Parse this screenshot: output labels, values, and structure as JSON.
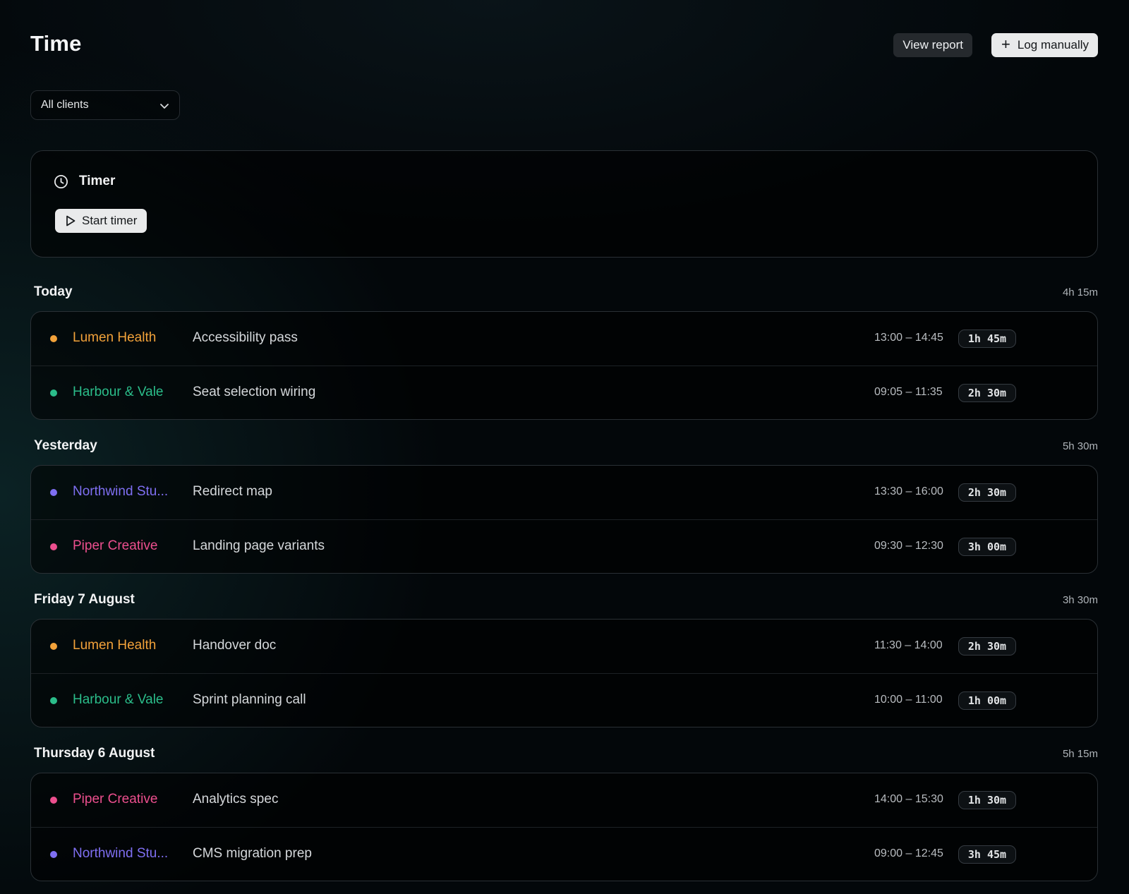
{
  "header": {
    "title": "Time",
    "view_report": "View report",
    "log_manually": "Log manually"
  },
  "filter": {
    "value": "All clients"
  },
  "timer": {
    "label": "Timer",
    "start": "Start timer"
  },
  "colors": {
    "lumen": "#f2a23a",
    "harbour": "#2bbd8a",
    "northwind": "#7f6ff2",
    "piper": "#ec4f8e"
  },
  "days": [
    {
      "label": "Today",
      "total": "4h 15m",
      "entries": [
        {
          "client": "Lumen Health",
          "color": "lumen",
          "task": "Accessibility pass",
          "range": "13:00 – 14:45",
          "duration": "1h 45m"
        },
        {
          "client": "Harbour & Vale",
          "color": "harbour",
          "task": "Seat selection wiring",
          "range": "09:05 – 11:35",
          "duration": "2h 30m"
        }
      ]
    },
    {
      "label": "Yesterday",
      "total": "5h 30m",
      "entries": [
        {
          "client": "Northwind Stu...",
          "color": "northwind",
          "task": "Redirect map",
          "range": "13:30 – 16:00",
          "duration": "2h 30m"
        },
        {
          "client": "Piper Creative",
          "color": "piper",
          "task": "Landing page variants",
          "range": "09:30 – 12:30",
          "duration": "3h 00m"
        }
      ]
    },
    {
      "label": "Friday 7 August",
      "total": "3h 30m",
      "entries": [
        {
          "client": "Lumen Health",
          "color": "lumen",
          "task": "Handover doc",
          "range": "11:30 – 14:00",
          "duration": "2h 30m"
        },
        {
          "client": "Harbour & Vale",
          "color": "harbour",
          "task": "Sprint planning call",
          "range": "10:00 – 11:00",
          "duration": "1h 00m"
        }
      ]
    },
    {
      "label": "Thursday 6 August",
      "total": "5h 15m",
      "entries": [
        {
          "client": "Piper Creative",
          "color": "piper",
          "task": "Analytics spec",
          "range": "14:00 – 15:30",
          "duration": "1h 30m"
        },
        {
          "client": "Northwind Stu...",
          "color": "northwind",
          "task": "CMS migration prep",
          "range": "09:00 – 12:45",
          "duration": "3h 45m"
        }
      ]
    }
  ]
}
